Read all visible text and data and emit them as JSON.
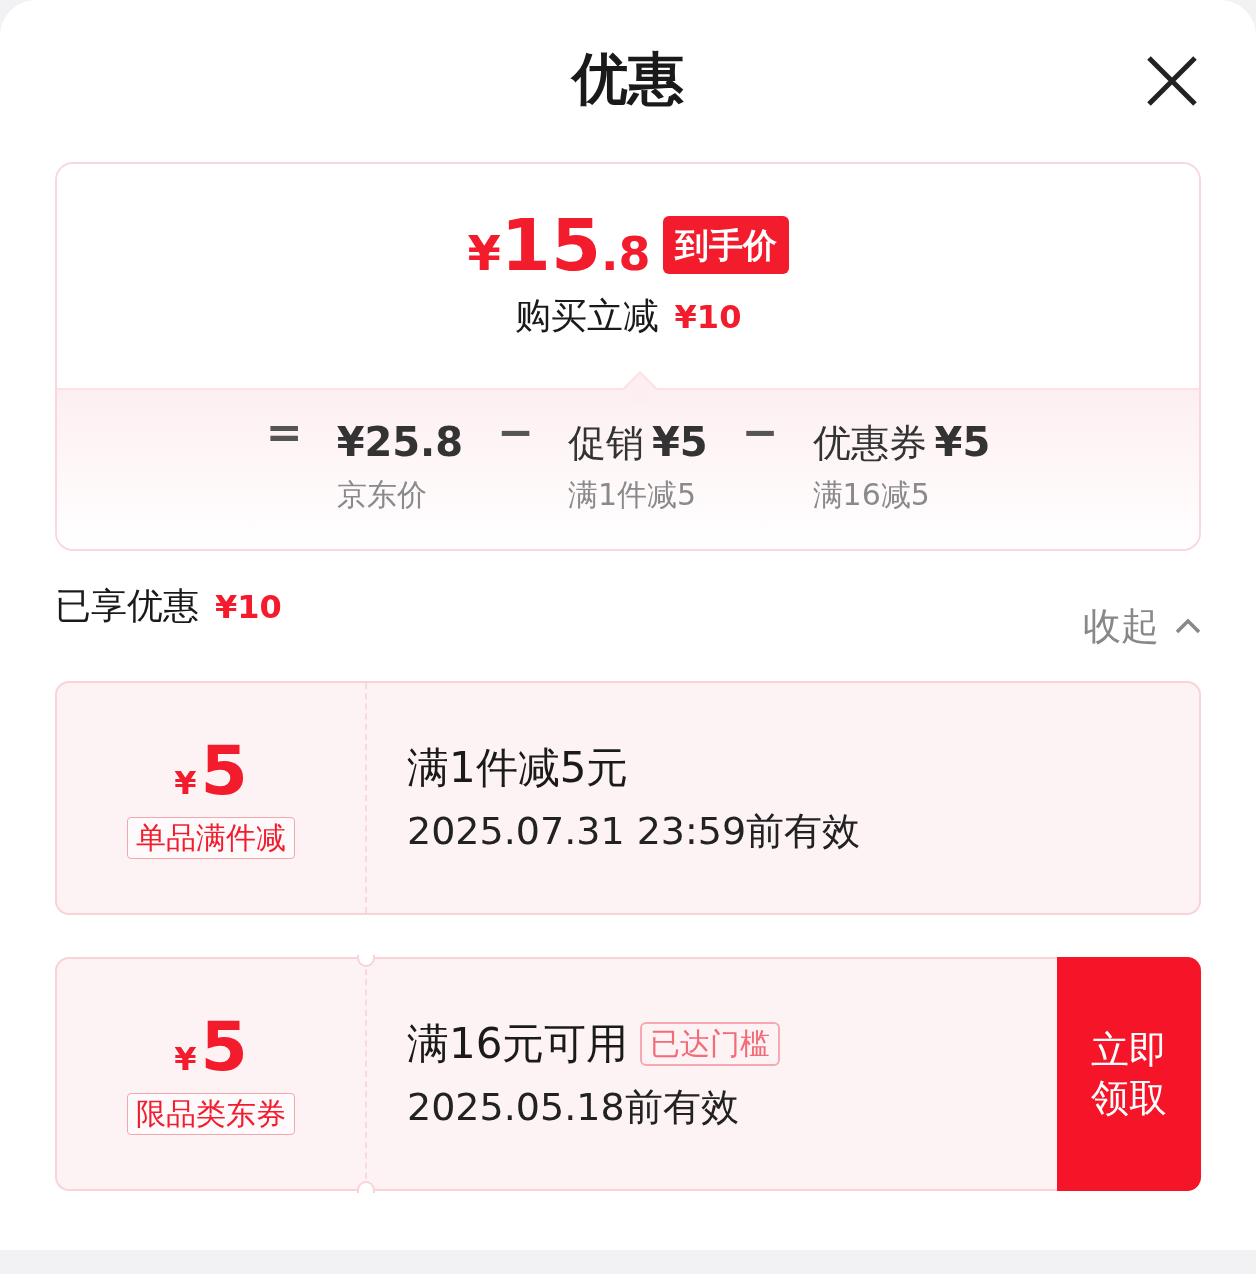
{
  "title": "优惠",
  "summary": {
    "currency": "¥",
    "price_integer": "15",
    "price_decimal": ".8",
    "price_badge": "到手价",
    "saving_label": "购买立减",
    "saving_amount": "¥10",
    "terms": [
      {
        "operator": "=",
        "amount": "¥25.8",
        "caption": "京东价"
      },
      {
        "operator": "−",
        "label": "促销",
        "amount": "¥5",
        "caption": "满1件减5"
      },
      {
        "operator": "−",
        "label": "优惠券",
        "amount": "¥5",
        "caption": "满16减5"
      }
    ]
  },
  "enjoyed": {
    "label": "已享优惠",
    "amount": "¥10",
    "toggle": "收起",
    "expanded": true
  },
  "coupons": [
    {
      "kind": "promotion",
      "currency": "¥",
      "value": "5",
      "tag": "单品满件减",
      "title": "满1件减5元",
      "validity": "2025.07.31 23:59前有效"
    },
    {
      "kind": "coupon",
      "currency": "¥",
      "value": "5",
      "tag": "限品类东券",
      "title": "满16元可用",
      "badge": "已达门槛",
      "validity": "2025.05.18前有效",
      "action": "立即领取"
    }
  ]
}
